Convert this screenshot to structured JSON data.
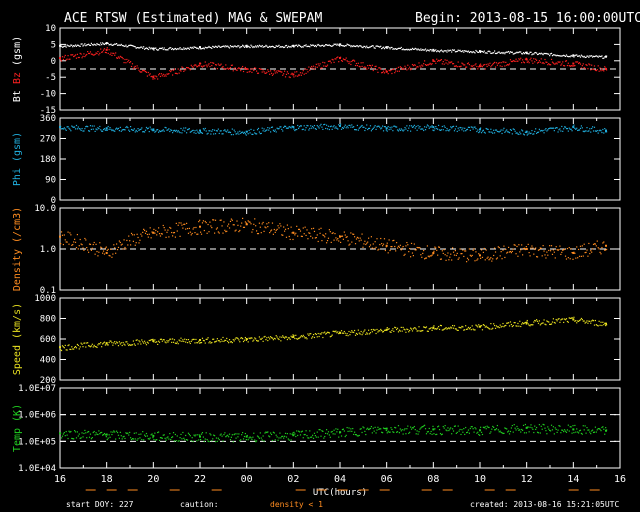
{
  "header": {
    "title": "ACE RTSW (Estimated) MAG & SWEPAM",
    "begin": "Begin: 2013-08-15 16:00:00UTC"
  },
  "footer": {
    "start_doy": "start DOY: 227",
    "caution_label": "caution:",
    "caution_note": "density < 1",
    "created": "created: 2013-08-16 15:21:05UTC"
  },
  "colors": {
    "background": "#000000",
    "axes": "#ffffff",
    "bt": "#ffffff",
    "bz": "#ff2020",
    "phi": "#20b0e0",
    "density": "#ff8c20",
    "speed": "#e8e020",
    "temp": "#20d020"
  },
  "chart_data": [
    {
      "type": "line",
      "panel": "mag",
      "ylabel_parts": [
        "Bt",
        "Bz",
        "(gsm)"
      ],
      "ylim": [
        -15,
        15
      ],
      "yticks": [
        "10",
        "5",
        "0",
        "-5",
        "-10",
        "-15"
      ],
      "reference_lines": [
        0
      ],
      "x_hours": [
        16,
        18,
        20,
        22,
        24,
        26,
        28,
        30,
        32,
        34,
        36,
        38,
        39.4
      ],
      "series": [
        {
          "name": "Bt",
          "values": [
            8.5,
            9.5,
            7.5,
            8.0,
            8.5,
            8.5,
            9.0,
            8.0,
            7.0,
            6.5,
            6.0,
            5.0,
            4.5
          ]
        },
        {
          "name": "Bz",
          "values": [
            4.0,
            7.0,
            -3.0,
            2.0,
            0.0,
            -2.0,
            4.0,
            -1.0,
            3.0,
            1.0,
            3.5,
            2.0,
            0.0
          ]
        }
      ]
    },
    {
      "type": "scatter",
      "panel": "phi",
      "ylabel": "Phi (gsm)",
      "ylim": [
        0,
        360
      ],
      "yticks": [
        "360",
        "270",
        "180",
        "90",
        "0"
      ],
      "x_hours": [
        16,
        18,
        20,
        22,
        24,
        26,
        28,
        30,
        32,
        34,
        36,
        38,
        39.4
      ],
      "series": [
        {
          "name": "Phi",
          "values": [
            320,
            315,
            310,
            305,
            300,
            320,
            325,
            315,
            320,
            310,
            300,
            320,
            305
          ]
        }
      ]
    },
    {
      "type": "scatter",
      "panel": "density",
      "ylabel": "Density (/cm3)",
      "yscale": "log",
      "ylim": [
        0.1,
        10
      ],
      "yticks": [
        "10.0",
        "1.0",
        "0.1"
      ],
      "reference_lines": [
        1
      ],
      "x_hours": [
        16,
        18,
        20,
        22,
        24,
        26,
        28,
        30,
        32,
        34,
        36,
        38,
        39.4
      ],
      "series": [
        {
          "name": "Density",
          "values": [
            2.0,
            0.8,
            2.5,
            3.5,
            4.0,
            2.5,
            2.0,
            1.2,
            0.8,
            0.7,
            1.0,
            0.8,
            1.2
          ]
        }
      ]
    },
    {
      "type": "line",
      "panel": "speed",
      "ylabel": "Speed (km/s)",
      "ylim": [
        200,
        1000
      ],
      "yticks": [
        "1000",
        "800",
        "600",
        "400",
        "200"
      ],
      "x_hours": [
        16,
        18,
        20,
        22,
        24,
        26,
        28,
        30,
        32,
        34,
        36,
        38,
        39.4
      ],
      "series": [
        {
          "name": "Speed",
          "values": [
            520,
            560,
            580,
            590,
            600,
            620,
            660,
            690,
            710,
            720,
            760,
            790,
            750
          ]
        }
      ]
    },
    {
      "type": "scatter",
      "panel": "temp",
      "ylabel": "Temp (K)",
      "yscale": "log",
      "ylim": [
        10000,
        10000000
      ],
      "yticks": [
        "1.0E+07",
        "1.0E+06",
        "1.0E+05",
        "1.0E+04"
      ],
      "reference_lines": [
        1000000,
        100000
      ],
      "x_hours": [
        16,
        18,
        20,
        22,
        24,
        26,
        28,
        30,
        32,
        34,
        36,
        38,
        39.4
      ],
      "series": [
        {
          "name": "Temp",
          "values": [
            200000,
            180000,
            160000,
            150000,
            150000,
            170000,
            220000,
            300000,
            280000,
            260000,
            320000,
            280000,
            250000
          ]
        }
      ],
      "xlabel": "UTC(hours)",
      "xticks": [
        "16",
        "18",
        "20",
        "22",
        "00",
        "02",
        "04",
        "06",
        "08",
        "10",
        "12",
        "14",
        "16"
      ]
    }
  ]
}
